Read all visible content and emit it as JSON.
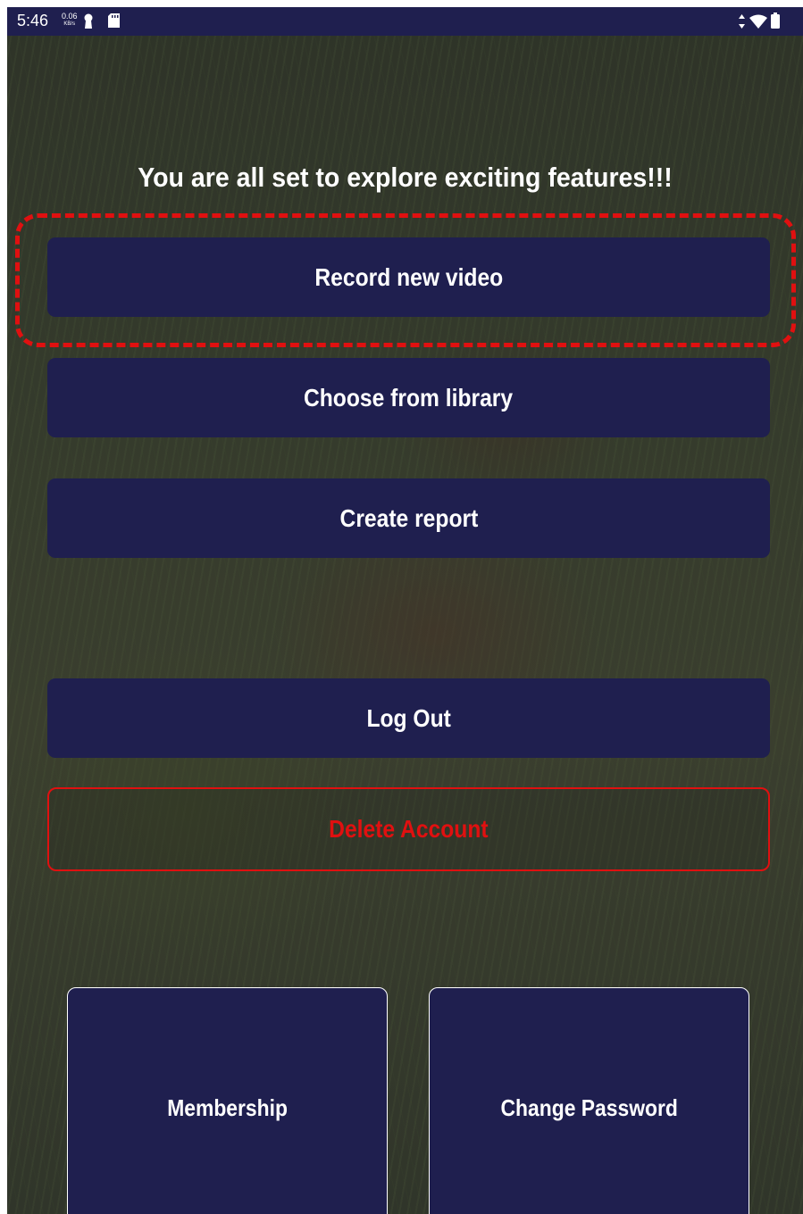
{
  "status_bar": {
    "time": "5:46",
    "net_speed_value": "0.06",
    "net_speed_unit": "KB/s",
    "icons": [
      "keyhole-icon",
      "sd-card-icon",
      "data-arrows-icon",
      "wifi-icon",
      "battery-icon"
    ],
    "background": "#1f1f4f"
  },
  "main": {
    "headline": "You are all set to explore exciting features!!!",
    "buttons": {
      "record": "Record new video",
      "library": "Choose from library",
      "report": "Create report",
      "logout": "Log Out",
      "delete": "Delete Account"
    },
    "tiles": {
      "membership": "Membership",
      "change_password": "Change Password"
    }
  },
  "colors": {
    "primary": "#1f1f4f",
    "danger": "#e01010",
    "text": "#ffffff"
  }
}
